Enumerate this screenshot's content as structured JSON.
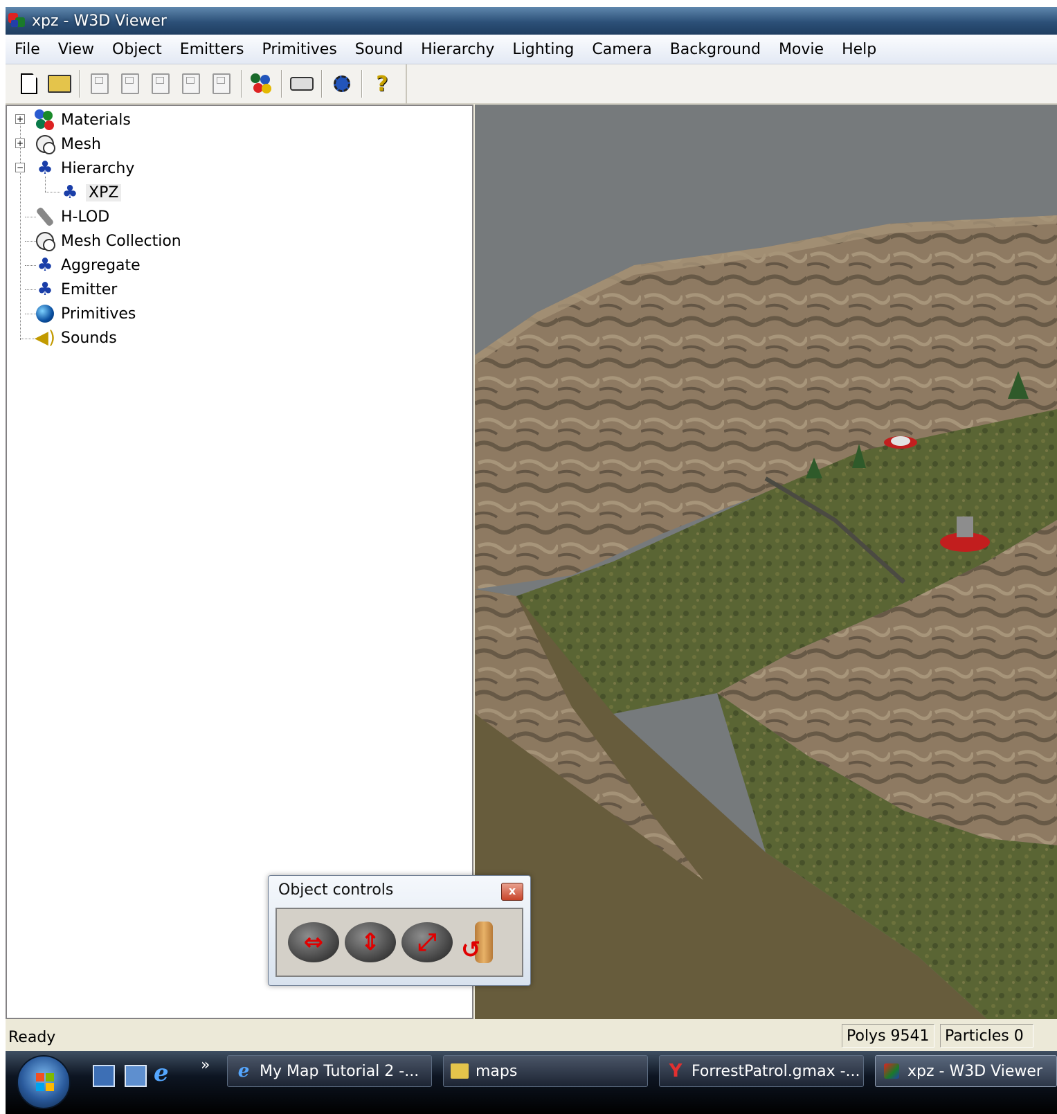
{
  "window": {
    "title": "xpz - W3D Viewer"
  },
  "menu": [
    "File",
    "View",
    "Object",
    "Emitters",
    "Primitives",
    "Sound",
    "Hierarchy",
    "Lighting",
    "Camera",
    "Background",
    "Movie",
    "Help"
  ],
  "toolbar": {
    "buttons": [
      "new-file",
      "open-folder",
      "save-1",
      "save-2",
      "save-3",
      "save-4",
      "save-5",
      "lod-tool",
      "keyboard",
      "add-object",
      "help"
    ]
  },
  "tree": {
    "items": [
      {
        "label": "Materials",
        "icon": "materials-icon",
        "expander": "+"
      },
      {
        "label": "Mesh",
        "icon": "mesh-icon",
        "expander": "+"
      },
      {
        "label": "Hierarchy",
        "icon": "hierarchy-icon",
        "expander": "−"
      },
      {
        "label": "XPZ",
        "icon": "hierarchy-icon"
      },
      {
        "label": "H-LOD",
        "icon": "hlod-icon"
      },
      {
        "label": "Mesh Collection",
        "icon": "mesh-icon"
      },
      {
        "label": "Aggregate",
        "icon": "hierarchy-icon"
      },
      {
        "label": "Emitter",
        "icon": "hierarchy-icon"
      },
      {
        "label": "Primitives",
        "icon": "globe-icon"
      },
      {
        "label": "Sounds",
        "icon": "speaker-icon"
      }
    ]
  },
  "object_controls": {
    "title": "Object controls",
    "close": "x",
    "buttons": [
      "move-horizontal",
      "move-vertical",
      "move-diagonal",
      "rotate"
    ]
  },
  "status": {
    "ready": "Ready",
    "polys": "Polys 9541",
    "particles": "Particles 0"
  },
  "taskbar": {
    "more": "»",
    "tasks": [
      {
        "label": "My Map Tutorial 2 -...",
        "icon": "ie-icon"
      },
      {
        "label": "maps",
        "icon": "folder-icon"
      },
      {
        "label": "ForrestPatrol.gmax -...",
        "icon": "gmax-icon"
      },
      {
        "label": "xpz - W3D Viewer",
        "icon": "w3d-icon"
      }
    ]
  },
  "colors": {
    "viewport_bg": "#767a7c",
    "rock": "#8e7a62",
    "grass": "#5a6534",
    "riverbed": "#675c3c"
  }
}
